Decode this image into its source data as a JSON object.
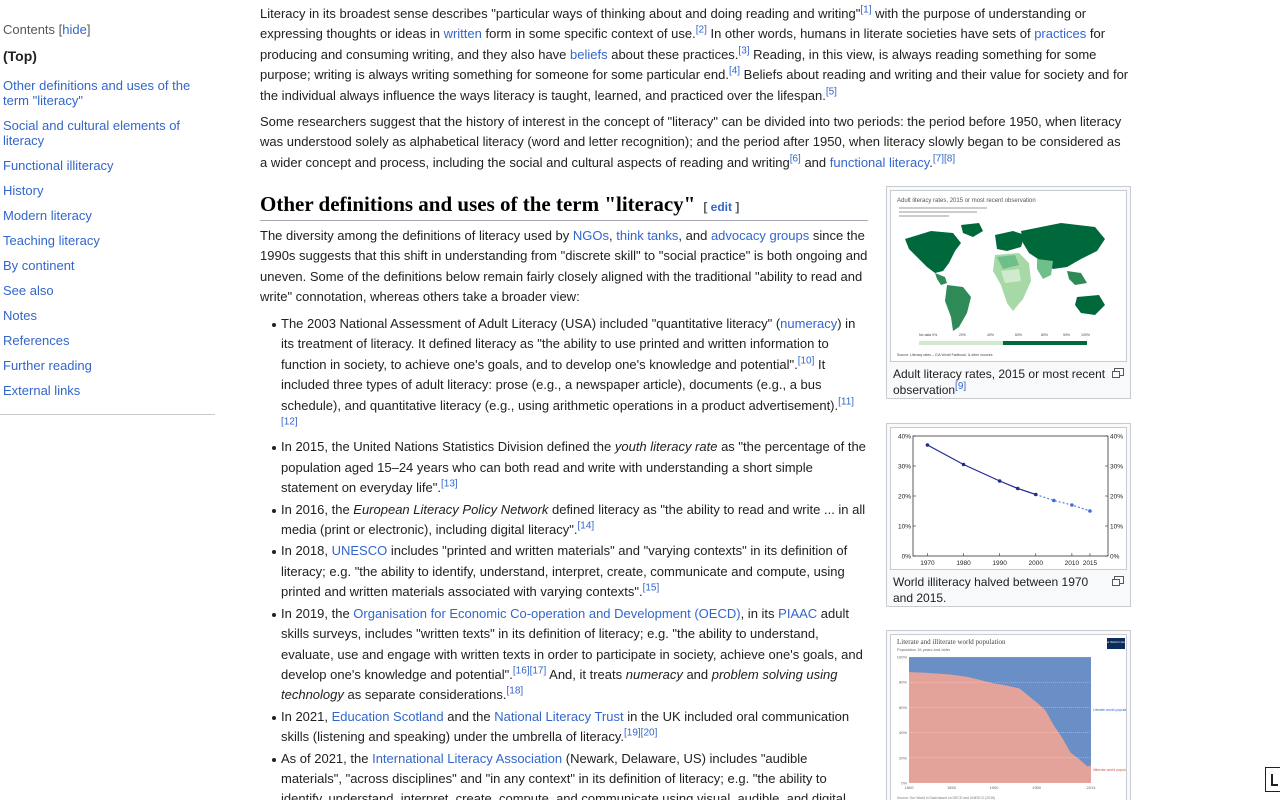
{
  "toc": {
    "title": "Contents",
    "hide_prefix": "[",
    "hide_label": "hide",
    "hide_suffix": "]",
    "items": [
      "(Top)",
      "Other definitions and uses of the term \"literacy\"",
      "Social and cultural elements of literacy",
      "Functional illiteracy",
      "History",
      "Modern literacy",
      "Teaching literacy",
      "By continent",
      "See also",
      "Notes",
      "References",
      "Further reading",
      "External links"
    ]
  },
  "article": {
    "p1": {
      "t1": "Literacy in its broadest sense describes \"particular ways of thinking about and doing reading and writing\"",
      "r1": "[1]",
      "t2": " with the purpose of understanding or expressing thoughts or ideas in ",
      "l1": "written",
      "t3": " form in some specific context of use.",
      "r2": "[2]",
      "t4": " In other words, humans in literate societies have sets of ",
      "l2": "practices",
      "t5": " for producing and consuming writing, and they also have ",
      "l3": "beliefs",
      "t6": " about these practices.",
      "r3": "[3]",
      "t7": " Reading, in this view, is always reading something for some purpose; writing is always writing something for someone for some particular end.",
      "r4": "[4]",
      "t8": " Beliefs about reading and writing and their value for society and for the individual always influence the ways literacy is taught, learned, and practiced over the lifespan.",
      "r5": "[5]"
    },
    "p2": {
      "t1": "Some researchers suggest that the history of interest in the concept of \"literacy\" can be divided into two periods: the period before 1950, when literacy was understood solely as alphabetical literacy (word and letter recognition); and the period after 1950, when literacy slowly began to be considered as a wider concept and process, including the social and cultural aspects of reading and writing",
      "r1": "[6]",
      "t2": " and ",
      "l1": "functional literacy",
      "t3": ".",
      "r2": "[7][8]"
    },
    "heading": "Other definitions and uses of the term \"literacy\"",
    "edit_open": "[ ",
    "edit_label": "edit",
    "edit_close": " ]",
    "p3": {
      "t1": "The diversity among the definitions of literacy used by ",
      "l1": "NGOs",
      "t2": ", ",
      "l2": "think tanks",
      "t3": ", and ",
      "l3": "advocacy groups",
      "t4": " since the 1990s suggests that this shift in understanding from \"discrete skill\" to \"social practice\" is both ongoing and uneven. Some of the definitions below remain fairly closely aligned with the traditional \"ability to read and write\" connotation, whereas others take a broader view:"
    },
    "list": [
      {
        "a": "The 2003 National Assessment of Adult Literacy (USA) included \"quantitative literacy\" (",
        "l": "numeracy",
        "b": ") in its treatment of literacy. It defined literacy as \"the ability to use printed and written information to function in society, to achieve one's goals, and to develop one's knowledge and potential\".",
        "r1": "[10]",
        "c": " It included three types of adult literacy: prose (e.g., a newspaper article), documents (e.g., a bus schedule), and quantitative literacy (e.g., using arithmetic operations in a product advertisement).",
        "r2": "[11][12]"
      },
      {
        "a": "In 2015, the United Nations Statistics Division defined the ",
        "i": "youth literacy rate",
        "b": " as \"the percentage of the population aged 15–24 years who can both read and write with understanding a short simple statement on everyday life\".",
        "r1": "[13]"
      },
      {
        "a": "In 2016, the ",
        "i": "European Literacy Policy Network",
        "b": " defined literacy as \"the ability to read and write ... in all media (print or electronic), including digital literacy\".",
        "r1": "[14]"
      },
      {
        "a": "In 2018, ",
        "l": "UNESCO",
        "b": " includes \"printed and written materials\" and \"varying contexts\" in its definition of literacy; e.g. \"the ability to identify, understand, interpret, create, communicate and compute, using printed and written materials associated with varying contexts\".",
        "r1": "[15]"
      },
      {
        "a": "In 2019, the ",
        "l": "Organisation for Economic Co-operation and Development (OECD)",
        "b": ", in its ",
        "l2": "PIAAC",
        "c": " adult skills surveys, includes \"written texts\" in its definition of literacy; e.g. \"the ability to understand, evaluate, use and engage with written texts in order to participate in society, achieve one's goals, and develop one's knowledge and potential\".",
        "r1": "[16][17]",
        "d": " And, it treats ",
        "i1": "numeracy",
        "e": " and ",
        "i2": "problem solving using technology",
        "f": " as separate considerations.",
        "r2": "[18]"
      },
      {
        "a": "In 2021, ",
        "l": "Education Scotland",
        "b": " and the ",
        "l2": "National Literacy Trust",
        "c": " in the UK included oral communication skills (listening and speaking) under the umbrella of literacy.",
        "r1": "[19][20]"
      },
      {
        "a": "As of 2021, the ",
        "l": "International Literacy Association",
        "b": " (Newark, Delaware, US) includes \"audible materials\", \"across disciplines\" and \"in any context\" in its definition of literacy; e.g. \"the ability to identify, understand, interpret, create, compute, and communicate using visual, audible, and digital"
      }
    ]
  },
  "figures": {
    "map": {
      "title": "Adult literacy rates, 2015 or most recent observation",
      "legend": [
        "No data 0%",
        "20%",
        "40%",
        "60%",
        "80%",
        "90%",
        "100%"
      ],
      "source": "Source: Literacy rates – CIA World Factbook, & other sources",
      "caption": "Adult literacy rates, 2015 or most recent observation",
      "ref": "[9]",
      "colors": {
        "high": "#00693c",
        "mid": "#6fbf8a",
        "low": "#cfeacd",
        "ocean": "#ffffff"
      }
    },
    "illiteracy": {
      "caption": "World illiteracy halved between 1970 and 2015.",
      "chart_data": {
        "type": "line",
        "x": [
          1970,
          1980,
          1990,
          1995,
          2000,
          2005,
          2010,
          2015
        ],
        "y": [
          37,
          30.5,
          25,
          22.5,
          20.5,
          18.5,
          17,
          15
        ],
        "projected_from": 2000,
        "xticks": [
          "1970",
          "1980",
          "1990",
          "2000",
          "2010",
          "2015"
        ],
        "yticks": [
          "0%",
          "10%",
          "20%",
          "30%",
          "40%"
        ],
        "xlim": [
          1966,
          2020
        ],
        "ylim": [
          0,
          40
        ],
        "color": "#1f2a8f"
      }
    },
    "population": {
      "title": "Literate and illiterate world population",
      "subtitle": "Population 15 years and older",
      "badge": "Our World in Data",
      "label_literate": "Literate world population",
      "label_illiterate": "Illiterate world population",
      "source": "Source: Our World in Data based on OECD and UNESCO (2016)",
      "chart_data": {
        "type": "area",
        "x": [
          1800,
          1820,
          1850,
          1870,
          1900,
          1910,
          1930,
          1950,
          1960,
          1970,
          1980,
          1990,
          2000,
          2010,
          2014
        ],
        "series": [
          {
            "name": "Illiterate world population",
            "values": [
              88,
              87.5,
              86,
              84,
              79,
              78,
              75,
              64,
              58,
              46,
              36,
              24,
              19,
              13,
              14
            ]
          }
        ],
        "yticks": [
          "0%",
          "20%",
          "40%",
          "60%",
          "80%",
          "100%"
        ],
        "xticks": [
          "1800",
          "1850",
          "1900",
          "1950",
          "2014"
        ],
        "xlim": [
          1800,
          2014
        ],
        "ylim": [
          0,
          100
        ],
        "colors": {
          "literate": "#6a8fc7",
          "illiterate": "#e3a39a"
        }
      }
    }
  }
}
